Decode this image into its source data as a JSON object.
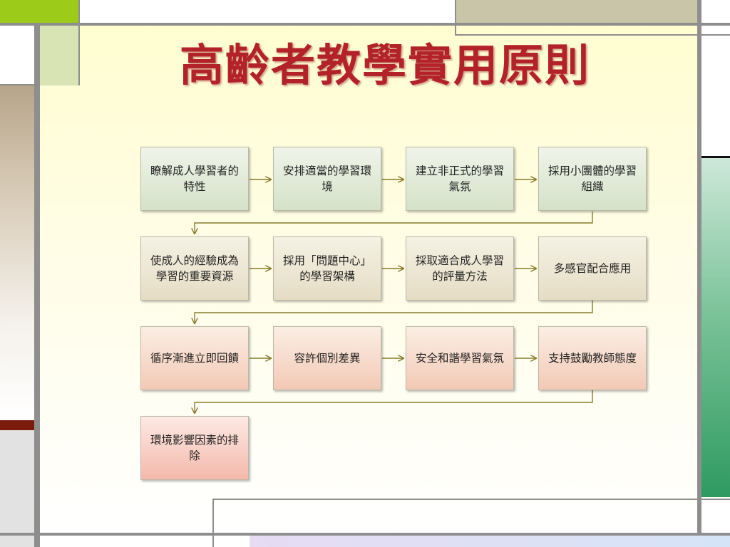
{
  "slide": {
    "title": "高齡者教學實用原則",
    "colors": {
      "title": "#b22228",
      "connector": "#8a7a2c",
      "frame": "#8e8e8e",
      "accent_green": "#9ccb19",
      "accent_red": "#7b1b0c",
      "accent_teal": "#2e9a60"
    }
  },
  "flow": {
    "steps": [
      {
        "label": "瞭解成人學習者的特性"
      },
      {
        "label": "安排適當的學習環境"
      },
      {
        "label": "建立非正式的學習氣氛"
      },
      {
        "label": "採用小團體的學習組織"
      },
      {
        "label": "使成人的經驗成為學習的重要資源"
      },
      {
        "label": "採用「問題中心」的學習架構"
      },
      {
        "label": "採取適合成人學習的評量方法"
      },
      {
        "label": "多感官配合應用"
      },
      {
        "label": "循序漸進立即回饋"
      },
      {
        "label": "容許個別差異"
      },
      {
        "label": "安全和諧學習氣氛"
      },
      {
        "label": "支持鼓勵教師態度"
      },
      {
        "label": "環境影響因素的排除"
      }
    ]
  }
}
